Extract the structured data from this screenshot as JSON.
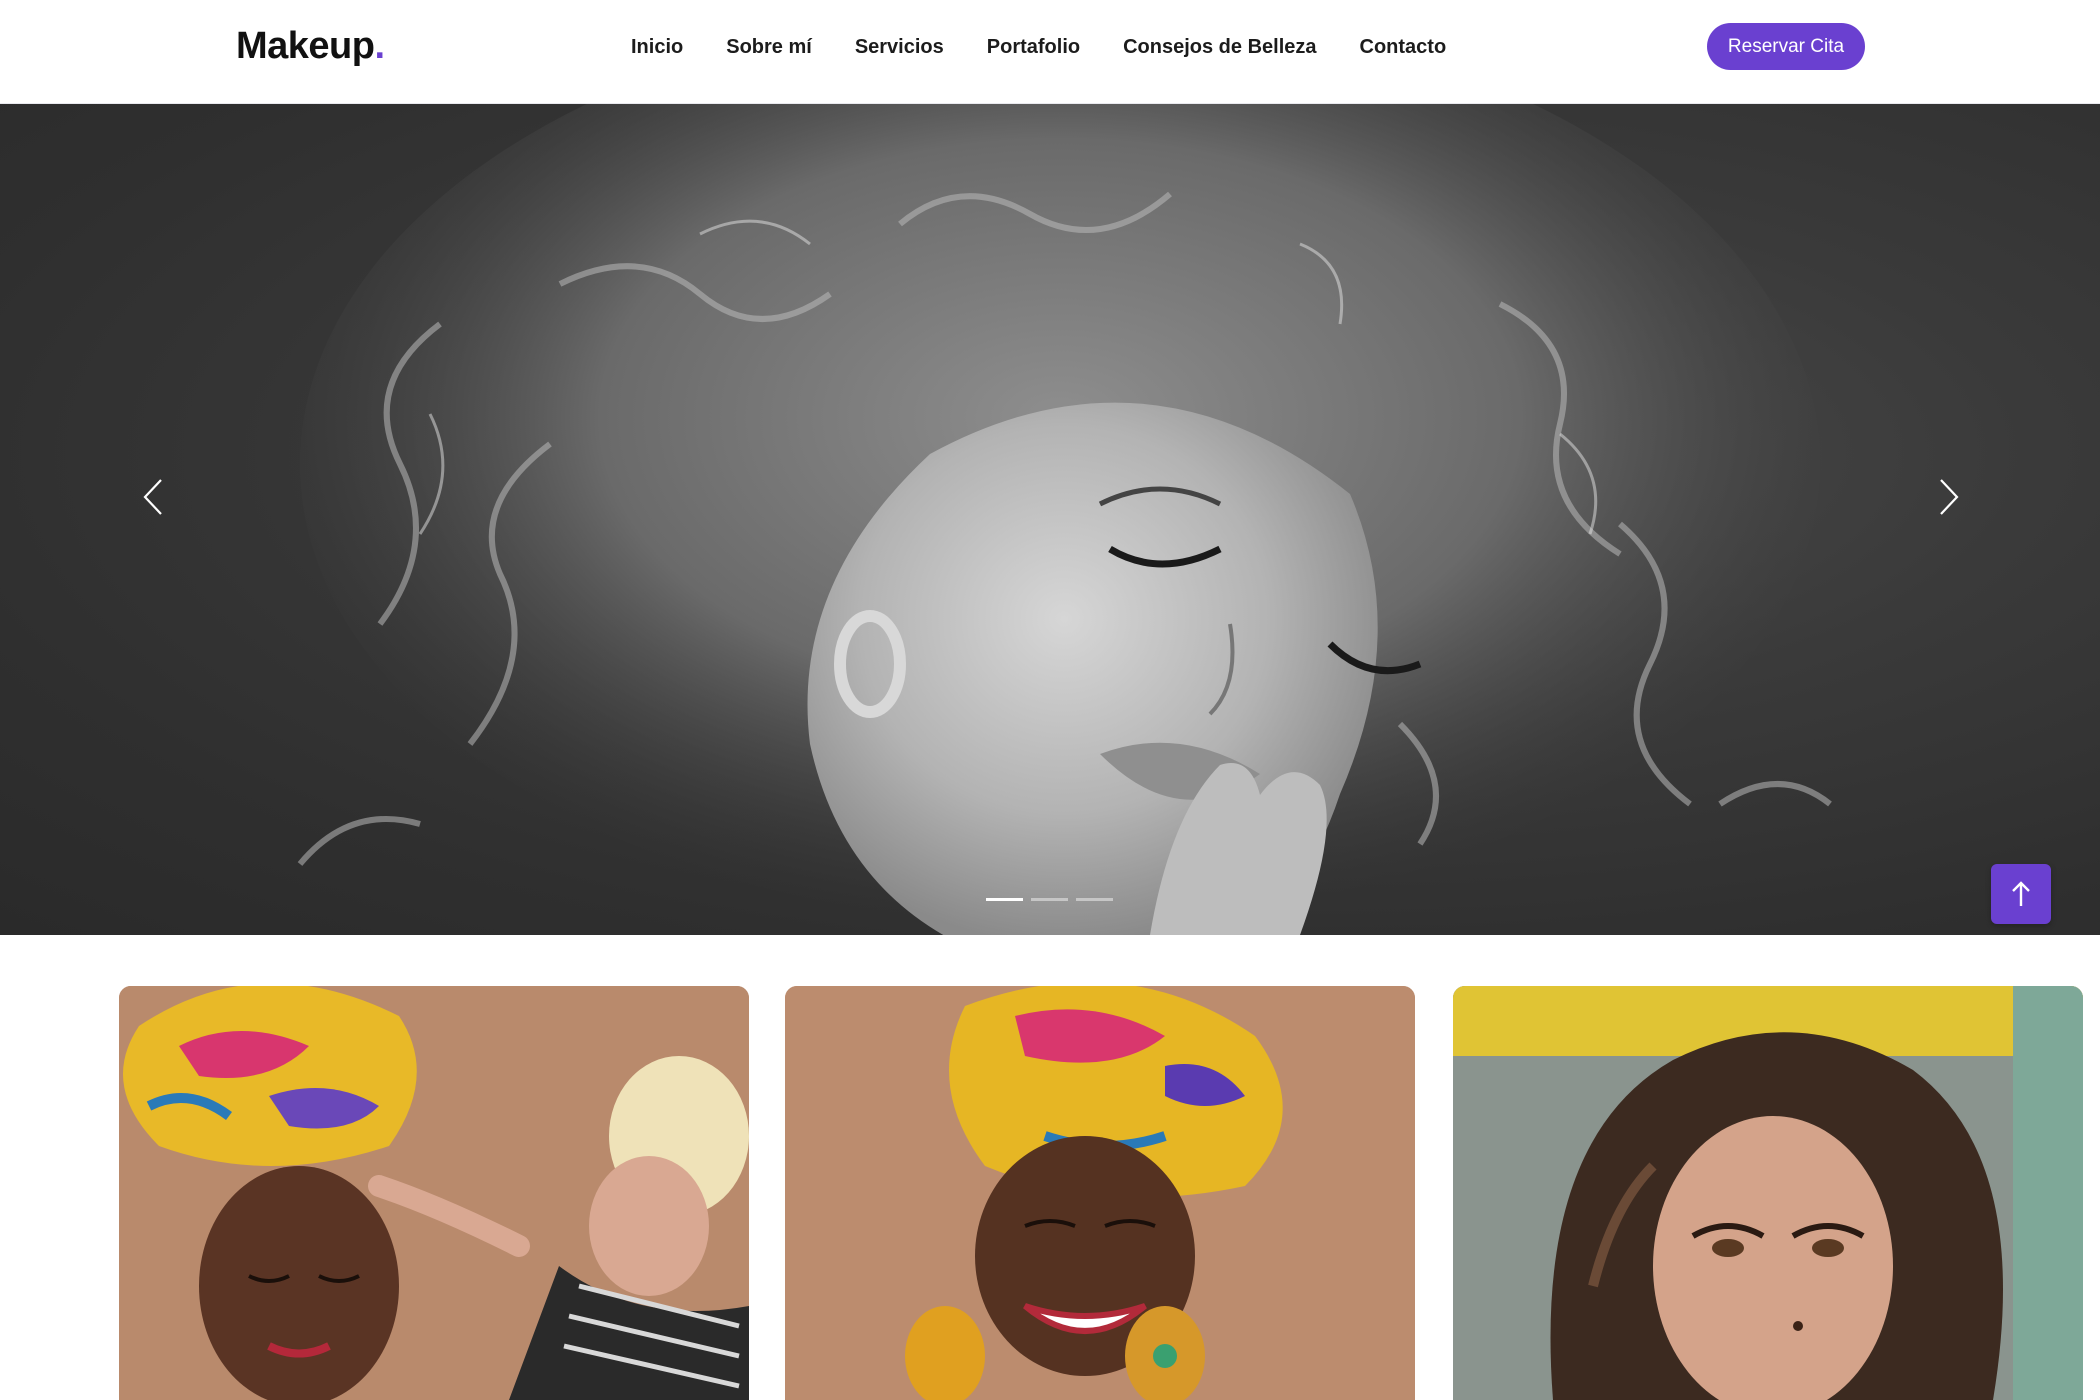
{
  "header": {
    "logo_text": "Makeup",
    "logo_dot": ".",
    "nav": [
      {
        "label": "Inicio"
      },
      {
        "label": "Sobre mí"
      },
      {
        "label": "Servicios"
      },
      {
        "label": "Portafolio"
      },
      {
        "label": "Consejos de Belleza"
      },
      {
        "label": "Contacto"
      }
    ],
    "cta_label": "Reservar Cita"
  },
  "hero": {
    "slide_count": 3,
    "active_slide": 1,
    "prev_icon": "chevron-left-icon",
    "next_icon": "chevron-right-icon"
  },
  "back_to_top": {
    "icon": "arrow-up-icon"
  },
  "gallery": [
    {
      "name": "woman-headwrap-makeup-application"
    },
    {
      "name": "woman-headwrap-smiling"
    },
    {
      "name": "woman-glam-makeup-portrait"
    }
  ],
  "colors": {
    "accent": "#6a40d0",
    "text": "#1c1c1c",
    "hero_bg": "#3a3a3a"
  }
}
